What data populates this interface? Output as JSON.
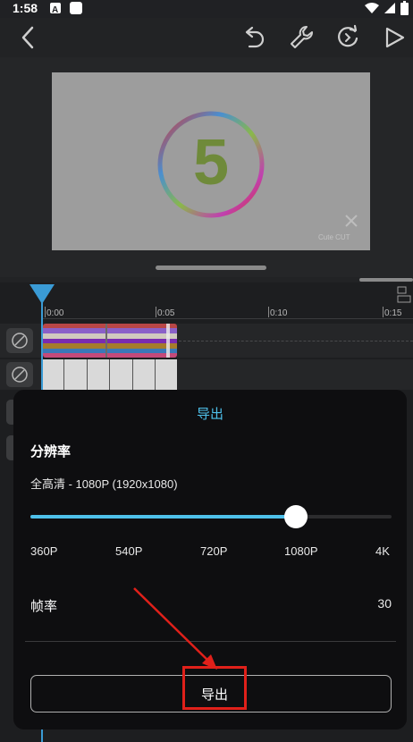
{
  "status_bar": {
    "time": "1:58"
  },
  "toolbar": {
    "back_icon": "back-arrow-icon",
    "undo_icon": "undo-icon",
    "tools_icon": "wrench-icon",
    "redo_icon": "redo-icon",
    "play_icon": "play-icon"
  },
  "preview": {
    "countdown_digit": "5",
    "watermark": "Cute CUT"
  },
  "timeline": {
    "ruler": [
      "0:00",
      "0:05",
      "0:10",
      "0:15"
    ]
  },
  "export_sheet": {
    "title": "导出",
    "resolution": {
      "title": "分辨率",
      "current": "全高清 - 1080P (1920x1080)",
      "options": [
        "360P",
        "540P",
        "720P",
        "1080P",
        "4K"
      ],
      "selected_fraction": 0.735
    },
    "frame_rate": {
      "label": "帧率",
      "value": "30"
    },
    "export_button": "导出"
  },
  "colors": {
    "accent": "#4ec0ea",
    "playhead": "#3a9bd5",
    "annotation": "#e0201a"
  }
}
